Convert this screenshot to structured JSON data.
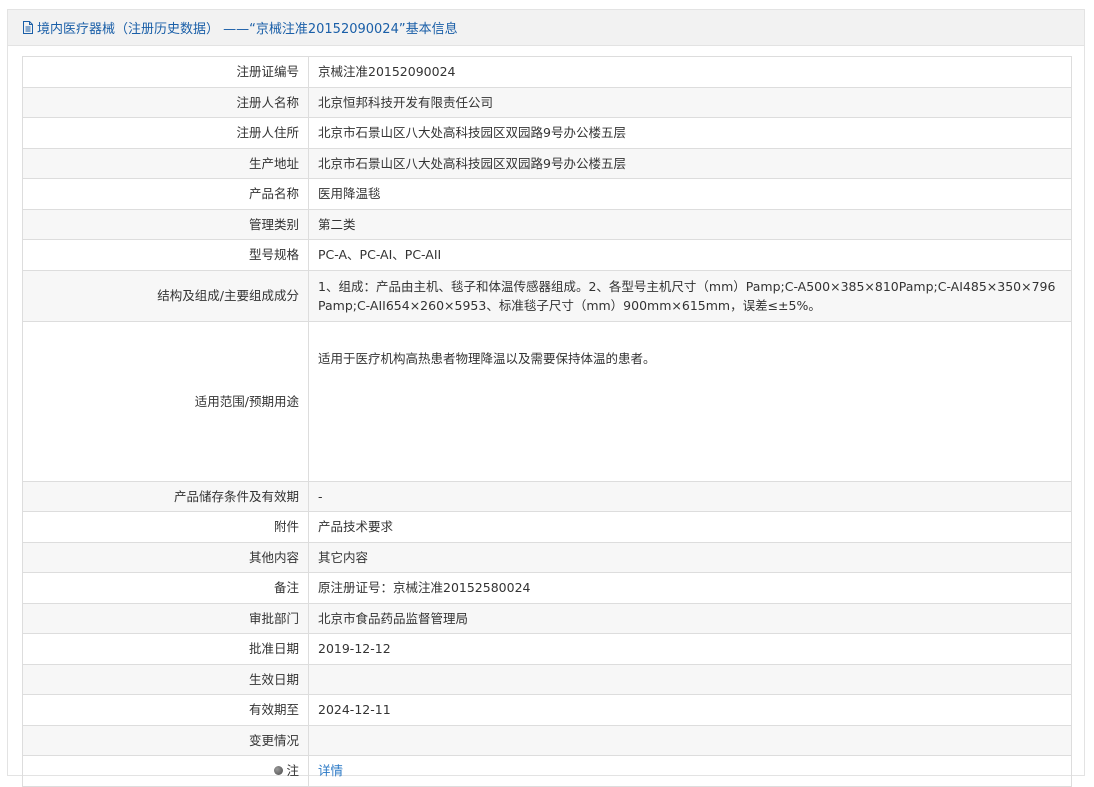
{
  "header": {
    "title": "境内医疗器械（注册历史数据） ——“京械注准20152090024”基本信息"
  },
  "rows": [
    {
      "label": "注册证编号",
      "value": "京械注准20152090024"
    },
    {
      "label": "注册人名称",
      "value": "北京恒邦科技开发有限责任公司"
    },
    {
      "label": "注册人住所",
      "value": "北京市石景山区八大处高科技园区双园路9号办公楼五层"
    },
    {
      "label": "生产地址",
      "value": "北京市石景山区八大处高科技园区双园路9号办公楼五层"
    },
    {
      "label": "产品名称",
      "value": "医用降温毯"
    },
    {
      "label": "管理类别",
      "value": "第二类"
    },
    {
      "label": "型号规格",
      "value": "PC-A、PC-AI、PC-AII"
    },
    {
      "label": "结构及组成/主要组成成分",
      "value": "1、组成：产品由主机、毯子和体温传感器组成。2、各型号主机尺寸（mm）Pamp;C-A500×385×810Pamp;C-AI485×350×796Pamp;C-AII654×260×5953、标准毯子尺寸（mm）900mm×615mm，误差≤±5%。"
    },
    {
      "label": "适用范围/预期用途",
      "value": "适用于医疗机构高热患者物理降温以及需要保持体温的患者。"
    },
    {
      "label": "产品储存条件及有效期",
      "value": "-"
    },
    {
      "label": "附件",
      "value": "产品技术要求"
    },
    {
      "label": "其他内容",
      "value": "其它内容"
    },
    {
      "label": "备注",
      "value": "原注册证号：京械注准20152580024"
    },
    {
      "label": "审批部门",
      "value": "北京市食品药品监督管理局"
    },
    {
      "label": "批准日期",
      "value": "2019-12-12"
    },
    {
      "label": "生效日期",
      "value": ""
    },
    {
      "label": "有效期至",
      "value": "2024-12-11"
    },
    {
      "label": "变更情况",
      "value": ""
    }
  ],
  "note": {
    "label": "注",
    "icon": "info-dot-icon",
    "link_text": "详情"
  }
}
